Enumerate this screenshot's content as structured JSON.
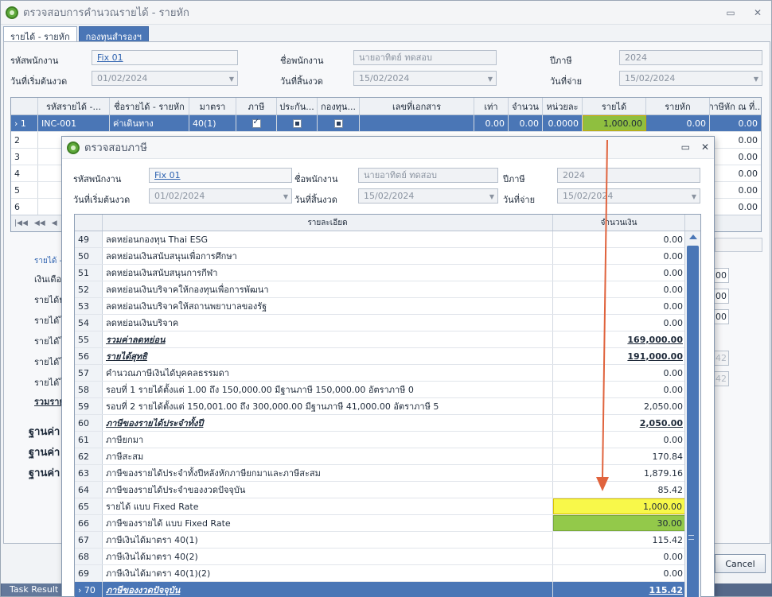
{
  "window": {
    "title": "ตรวจสอบการคำนวณรายได้ - รายหัก"
  },
  "tabs": [
    {
      "label": "รายได้ - รายหัก"
    },
    {
      "label": "กองทุนสำรองฯ"
    }
  ],
  "main_form": {
    "emp_code_label": "รหัสพนักงาน",
    "emp_code": "Fix 01",
    "emp_name_label": "ชื่อพนักงาน",
    "emp_name": "นายอาทิตย์ ทดสอบ",
    "tax_year_label": "ปีภาษี",
    "tax_year": "2024",
    "start_date_label": "วันที่เริ่มต้นงวด",
    "start_date": "01/02/2024",
    "end_date_label": "วันที่สิ้นงวด",
    "end_date": "15/02/2024",
    "pay_date_label": "วันที่จ่าย",
    "pay_date": "15/02/2024"
  },
  "main_grid": {
    "headers": [
      "รหัสรายได้ -...",
      "ชื่อรายได้ - รายหัก",
      "มาตรา",
      "ภาษี",
      "ประกัน...",
      "กองทุน...",
      "เลขที่เอกสาร",
      "เท่า",
      "จำนวน",
      "หน่วยละ",
      "รายได้",
      "รายหัก",
      "ภาษีหัก ณ ที่..."
    ],
    "row1": {
      "num": "1",
      "code": "INC-001",
      "name": "ค่าเดินทาง",
      "section": "40(1)",
      "doc_no": "",
      "times": "0.00",
      "qty": "0.00",
      "unit": "0.0000",
      "income": "1,000.00",
      "deduct": "0.00",
      "wht": "0.00"
    },
    "other_rows": [
      {
        "num": "2",
        "wht": "0.00"
      },
      {
        "num": "3",
        "wht": "0.00"
      },
      {
        "num": "4",
        "wht": "0.00"
      },
      {
        "num": "5",
        "wht": "0.00"
      },
      {
        "num": "6",
        "wht": "0.00"
      }
    ],
    "pager_letter": "R"
  },
  "behind": {
    "l1": "รายได้ -",
    "l2": "เงินเดือ",
    "l3": "รายได้ป",
    "l4": "รายได้ไ",
    "l5": "รายได้ไ",
    "l6": "รายได้ไ",
    "l7": "รายได้ไ",
    "l8": "รวมราย",
    "l9": "ฐานค่า",
    "l10": "ฐานค่า",
    "l11": "ฐานค่า",
    "f1": "00",
    "f2": "00",
    "f3": "00",
    "f4": "42",
    "f5": "42"
  },
  "cancel_label": "Cancel",
  "task_result": "Task Result",
  "dialog": {
    "title": "ตรวจสอบภาษี",
    "emp_code_label": "รหัสพนักงาน",
    "emp_code": "Fix 01",
    "emp_name_label": "ชื่อพนักงาน",
    "emp_name": "นายอาทิตย์ ทดสอบ",
    "tax_year_label": "ปีภาษี",
    "tax_year": "2024",
    "start_date_label": "วันที่เริ่มต้นงวด",
    "start_date": "01/02/2024",
    "end_date_label": "วันที่สิ้นงวด",
    "end_date": "15/02/2024",
    "pay_date_label": "วันที่จ่าย",
    "pay_date": "15/02/2024",
    "col_detail": "รายละเอียด",
    "col_amount": "จำนวนเงิน",
    "rows": [
      {
        "n": "49",
        "d": "ลดหย่อนกองทุน Thai ESG",
        "v": "0.00"
      },
      {
        "n": "50",
        "d": "ลดหย่อนเงินสนับสนุนเพื่อการศึกษา",
        "v": "0.00"
      },
      {
        "n": "51",
        "d": "ลดหย่อนเงินสนับสนุนการกีฬา",
        "v": "0.00"
      },
      {
        "n": "52",
        "d": "ลดหย่อนเงินบริจาคให้กองทุนเพื่อการพัฒนา",
        "v": "0.00"
      },
      {
        "n": "53",
        "d": "ลดหย่อนเงินบริจาคให้สถานพยาบาลของรัฐ",
        "v": "0.00"
      },
      {
        "n": "54",
        "d": "ลดหย่อนเงินบริจาค",
        "v": "0.00"
      },
      {
        "n": "55",
        "d": "รวมค่าลดหย่อน",
        "v": "169,000.00"
      },
      {
        "n": "56",
        "d": "รายได้สุทธิ",
        "v": "191,000.00"
      },
      {
        "n": "57",
        "d": "คำนวณภาษีเงินได้บุคคลธรรมดา",
        "v": "0.00"
      },
      {
        "n": "58",
        "d": "รอบที่  1 รายได้ตั้งแต่ 1.00 ถึง 150,000.00 มีฐานภาษี 150,000.00 อัตราภาษี 0",
        "v": "0.00"
      },
      {
        "n": "59",
        "d": "รอบที่  2 รายได้ตั้งแต่ 150,001.00 ถึง 300,000.00 มีฐานภาษี 41,000.00 อัตราภาษี 5",
        "v": "2,050.00"
      },
      {
        "n": "60",
        "d": "ภาษีของรายได้ประจำทั้งปี",
        "v": "2,050.00"
      },
      {
        "n": "61",
        "d": "ภาษียกมา",
        "v": "0.00"
      },
      {
        "n": "62",
        "d": "ภาษีสะสม",
        "v": "170.84"
      },
      {
        "n": "63",
        "d": "ภาษีของรายได้ประจำทั้งปีหลังหักภาษียกมาและภาษีสะสม",
        "v": "1,879.16"
      },
      {
        "n": "64",
        "d": "ภาษีของรายได้ประจำของงวดปัจจุบัน",
        "v": "85.42"
      },
      {
        "n": "65",
        "d": "รายได้ แบบ Fixed Rate",
        "v": "1,000.00"
      },
      {
        "n": "66",
        "d": "ภาษีของรายได้ แบบ Fixed Rate",
        "v": "30.00"
      },
      {
        "n": "67",
        "d": "ภาษีเงินได้มาตรา 40(1)",
        "v": "115.42"
      },
      {
        "n": "68",
        "d": "ภาษีเงินได้มาตรา 40(2)",
        "v": "0.00"
      },
      {
        "n": "69",
        "d": "ภาษีเงินได้มาตรา 40(1)(2)",
        "v": "0.00"
      },
      {
        "n": "70",
        "d": "ภาษีของงวดปัจจุบัน",
        "v": "115.42"
      }
    ]
  },
  "colors": {
    "accent": "#4a76b6",
    "highlight_yellow": "#f8f84a",
    "highlight_green": "#93c94a",
    "arrow": "#e0633d"
  }
}
